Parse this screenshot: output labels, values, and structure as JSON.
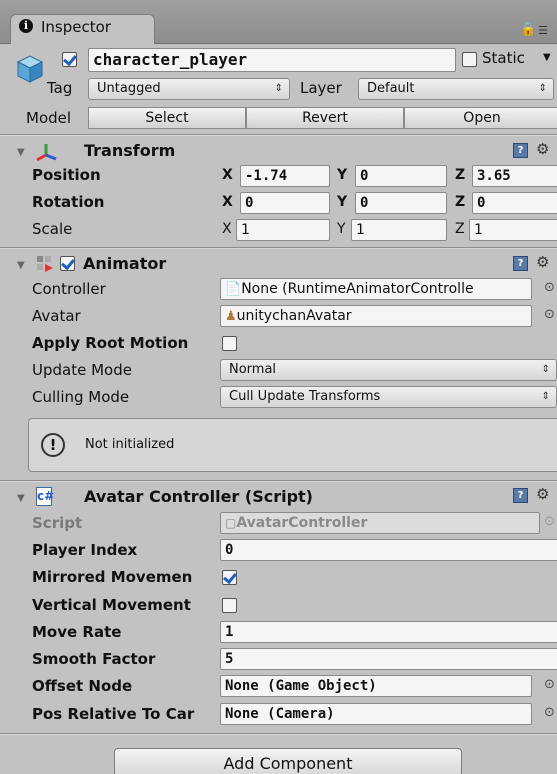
{
  "window": {
    "tab_label": "Inspector",
    "tab_icon": "i"
  },
  "gameobject": {
    "active": true,
    "name": "character_player",
    "static_label": "Static",
    "static_checked": false,
    "tag_label": "Tag",
    "tag_value": "Untagged",
    "layer_label": "Layer",
    "layer_value": "Default",
    "model_label": "Model",
    "model_buttons": [
      "Select",
      "Revert",
      "Open"
    ]
  },
  "transform": {
    "title": "Transform",
    "rows": [
      {
        "label": "Position",
        "bold": true,
        "x": "-1.74",
        "y": "0",
        "z": "3.65"
      },
      {
        "label": "Rotation",
        "bold": true,
        "x": "0",
        "y": "0",
        "z": "0"
      },
      {
        "label": "Scale",
        "bold": false,
        "x": "1",
        "y": "1",
        "z": "1"
      }
    ],
    "axes": [
      "X",
      "Y",
      "Z"
    ]
  },
  "animator": {
    "title": "Animator",
    "enabled": true,
    "controller_label": "Controller",
    "controller_value": "None (RuntimeAnimatorControlle",
    "avatar_label": "Avatar",
    "avatar_value": "unitychanAvatar",
    "apply_root_label": "Apply Root Motion",
    "apply_root_checked": false,
    "update_mode_label": "Update Mode",
    "update_mode_value": "Normal",
    "culling_mode_label": "Culling Mode",
    "culling_mode_value": "Cull Update Transforms",
    "warning": "Not initialized"
  },
  "avatar_controller": {
    "title": "Avatar Controller (Script)",
    "script_label": "Script",
    "script_value": "AvatarController",
    "player_index_label": "Player Index",
    "player_index_value": "0",
    "mirrored_label": "Mirrored Movemen",
    "mirrored_checked": true,
    "vertical_label": "Vertical Movement",
    "vertical_checked": false,
    "move_rate_label": "Move Rate",
    "move_rate_value": "1",
    "smooth_label": "Smooth Factor",
    "smooth_value": "5",
    "offset_label": "Offset Node",
    "offset_value": "None (Game Object)",
    "pos_rel_label": "Pos Relative To Car",
    "pos_rel_value": "None (Camera)"
  },
  "footer": {
    "add_component": "Add Component"
  },
  "colors": {
    "panel": "#c2c2c2",
    "field": "#f5f5f5",
    "check": "#1f5fbf",
    "help": "#5b79a5"
  }
}
